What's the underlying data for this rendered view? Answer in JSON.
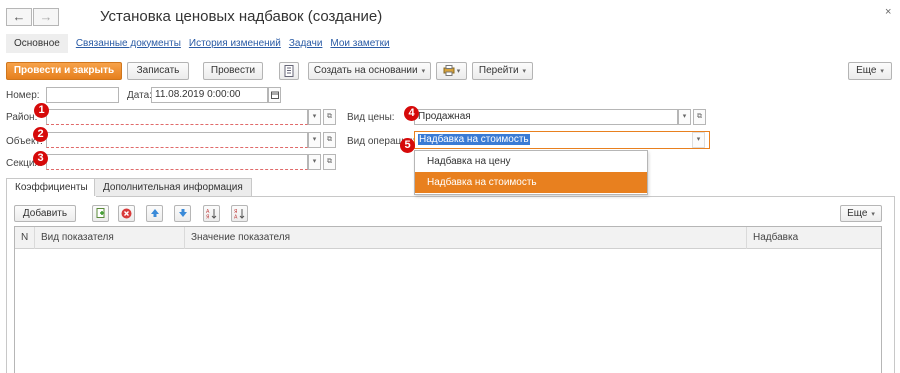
{
  "window": {
    "back_glyph": "←",
    "forward_glyph": "→",
    "title": "Установка ценовых надбавок (создание)",
    "close_glyph": "×"
  },
  "topnav": {
    "active": "Основное",
    "links": [
      "Связанные документы",
      "История изменений",
      "Задачи",
      "Мои заметки"
    ]
  },
  "toolbar": {
    "post_close": "Провести и закрыть",
    "save": "Записать",
    "post": "Провести",
    "create_based": "Создать на основании",
    "goto": "Перейти",
    "more": "Еще",
    "dropdown_glyph": "▾"
  },
  "form": {
    "number_label": "Номер:",
    "number_value": "",
    "date_label": "Дата:",
    "date_value": "11.08.2019  0:00:00",
    "district_label": "Район:",
    "object_label": "Объект:",
    "section_label": "Секция:",
    "price_type_label": "Вид цены:",
    "price_type_value": "Продажная",
    "operation_label": "Вид операции:",
    "operation_value": "Надбавка на стоимость"
  },
  "badges": [
    "1",
    "2",
    "3",
    "4",
    "5"
  ],
  "operation_options": [
    {
      "label": "Надбавка на цену",
      "selected": false
    },
    {
      "label": "Надбавка на стоимость",
      "selected": true
    }
  ],
  "tabs": [
    "Коэффициенты",
    "Дополнительная информация"
  ],
  "table_toolbar": {
    "add": "Добавить",
    "more": "Еще"
  },
  "table": {
    "columns": [
      "N",
      "Вид показателя",
      "Значение показателя",
      "Надбавка"
    ],
    "rows": []
  },
  "colors": {
    "accent": "#e8801f",
    "badge": "#d60a0a",
    "selection": "#3a7bd5",
    "link": "#2a5ba5"
  }
}
